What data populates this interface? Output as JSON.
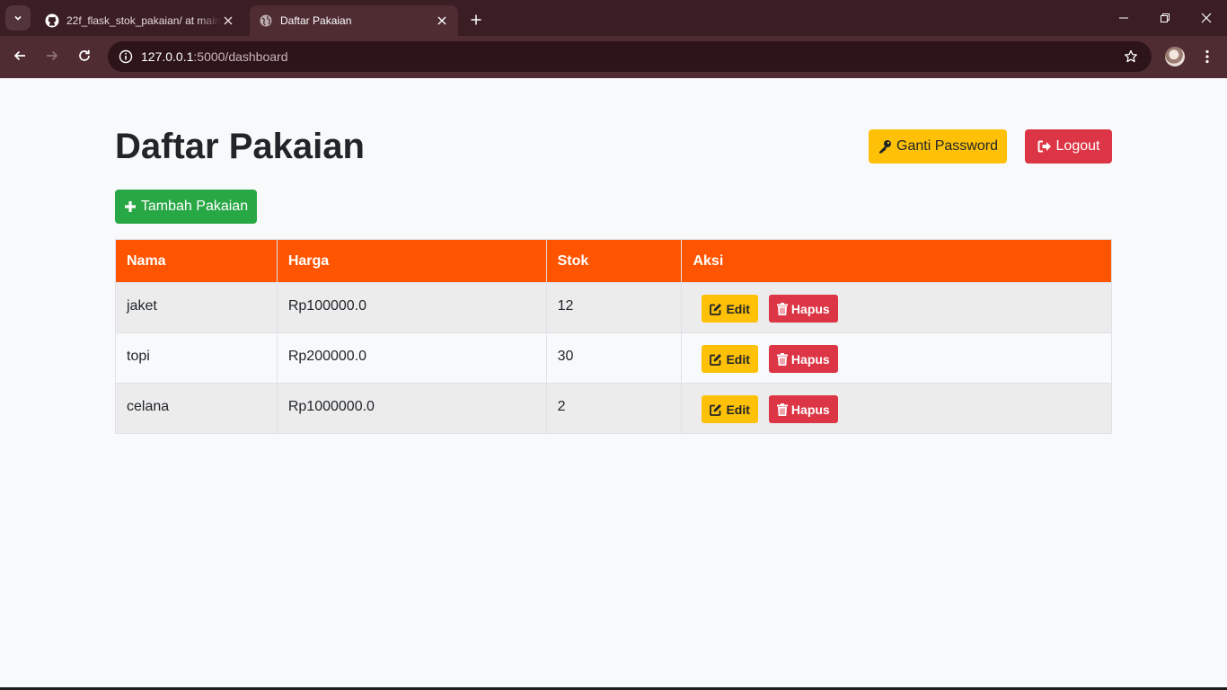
{
  "browser": {
    "tabs": [
      {
        "title": "22f_flask_stok_pakaian/ at main",
        "icon": "github-icon",
        "active": false
      },
      {
        "title": "Daftar Pakaian",
        "icon": "globe-icon",
        "active": true
      }
    ],
    "url_host": "127.0.0.1",
    "url_path": ":5000/dashboard"
  },
  "page": {
    "title": "Daftar Pakaian",
    "buttons": {
      "ganti_password": "Ganti Password",
      "logout": "Logout",
      "tambah": "Tambah Pakaian"
    }
  },
  "table": {
    "headers": [
      "Nama",
      "Harga",
      "Stok",
      "Aksi"
    ],
    "rows": [
      {
        "nama": "jaket",
        "harga": "Rp100000.0",
        "stok": "12"
      },
      {
        "nama": "topi",
        "harga": "Rp200000.0",
        "stok": "30"
      },
      {
        "nama": "celana",
        "harga": "Rp1000000.0",
        "stok": "2"
      }
    ],
    "actions": {
      "edit": "Edit",
      "hapus": "Hapus"
    }
  },
  "colors": {
    "header": "#ff5400",
    "warning": "#ffc107",
    "danger": "#dc3545",
    "success": "#28a745",
    "chrome": "#4e2c32"
  }
}
